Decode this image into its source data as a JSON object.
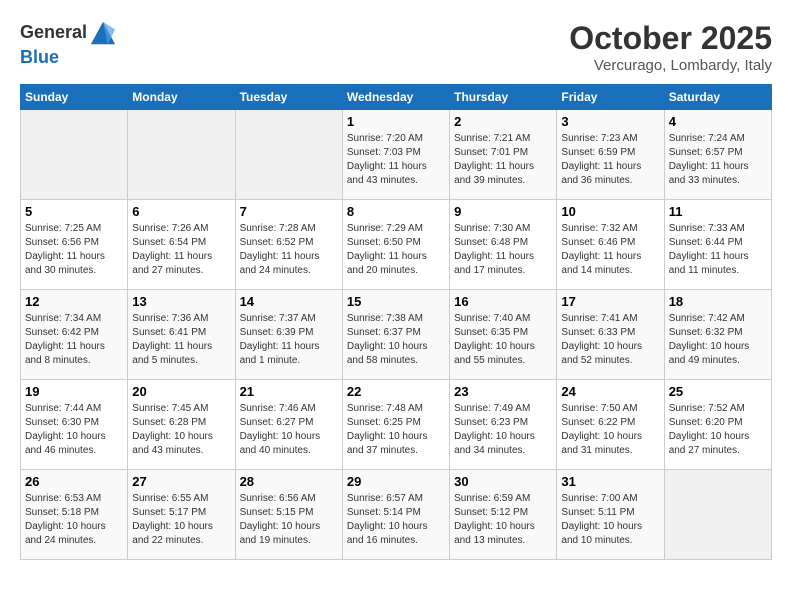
{
  "logo": {
    "general": "General",
    "blue": "Blue"
  },
  "title": "October 2025",
  "location": "Vercurago, Lombardy, Italy",
  "days_of_week": [
    "Sunday",
    "Monday",
    "Tuesday",
    "Wednesday",
    "Thursday",
    "Friday",
    "Saturday"
  ],
  "weeks": [
    [
      {
        "day": "",
        "info": ""
      },
      {
        "day": "",
        "info": ""
      },
      {
        "day": "",
        "info": ""
      },
      {
        "day": "1",
        "info": "Sunrise: 7:20 AM\nSunset: 7:03 PM\nDaylight: 11 hours and 43 minutes."
      },
      {
        "day": "2",
        "info": "Sunrise: 7:21 AM\nSunset: 7:01 PM\nDaylight: 11 hours and 39 minutes."
      },
      {
        "day": "3",
        "info": "Sunrise: 7:23 AM\nSunset: 6:59 PM\nDaylight: 11 hours and 36 minutes."
      },
      {
        "day": "4",
        "info": "Sunrise: 7:24 AM\nSunset: 6:57 PM\nDaylight: 11 hours and 33 minutes."
      }
    ],
    [
      {
        "day": "5",
        "info": "Sunrise: 7:25 AM\nSunset: 6:56 PM\nDaylight: 11 hours and 30 minutes."
      },
      {
        "day": "6",
        "info": "Sunrise: 7:26 AM\nSunset: 6:54 PM\nDaylight: 11 hours and 27 minutes."
      },
      {
        "day": "7",
        "info": "Sunrise: 7:28 AM\nSunset: 6:52 PM\nDaylight: 11 hours and 24 minutes."
      },
      {
        "day": "8",
        "info": "Sunrise: 7:29 AM\nSunset: 6:50 PM\nDaylight: 11 hours and 20 minutes."
      },
      {
        "day": "9",
        "info": "Sunrise: 7:30 AM\nSunset: 6:48 PM\nDaylight: 11 hours and 17 minutes."
      },
      {
        "day": "10",
        "info": "Sunrise: 7:32 AM\nSunset: 6:46 PM\nDaylight: 11 hours and 14 minutes."
      },
      {
        "day": "11",
        "info": "Sunrise: 7:33 AM\nSunset: 6:44 PM\nDaylight: 11 hours and 11 minutes."
      }
    ],
    [
      {
        "day": "12",
        "info": "Sunrise: 7:34 AM\nSunset: 6:42 PM\nDaylight: 11 hours and 8 minutes."
      },
      {
        "day": "13",
        "info": "Sunrise: 7:36 AM\nSunset: 6:41 PM\nDaylight: 11 hours and 5 minutes."
      },
      {
        "day": "14",
        "info": "Sunrise: 7:37 AM\nSunset: 6:39 PM\nDaylight: 11 hours and 1 minute."
      },
      {
        "day": "15",
        "info": "Sunrise: 7:38 AM\nSunset: 6:37 PM\nDaylight: 10 hours and 58 minutes."
      },
      {
        "day": "16",
        "info": "Sunrise: 7:40 AM\nSunset: 6:35 PM\nDaylight: 10 hours and 55 minutes."
      },
      {
        "day": "17",
        "info": "Sunrise: 7:41 AM\nSunset: 6:33 PM\nDaylight: 10 hours and 52 minutes."
      },
      {
        "day": "18",
        "info": "Sunrise: 7:42 AM\nSunset: 6:32 PM\nDaylight: 10 hours and 49 minutes."
      }
    ],
    [
      {
        "day": "19",
        "info": "Sunrise: 7:44 AM\nSunset: 6:30 PM\nDaylight: 10 hours and 46 minutes."
      },
      {
        "day": "20",
        "info": "Sunrise: 7:45 AM\nSunset: 6:28 PM\nDaylight: 10 hours and 43 minutes."
      },
      {
        "day": "21",
        "info": "Sunrise: 7:46 AM\nSunset: 6:27 PM\nDaylight: 10 hours and 40 minutes."
      },
      {
        "day": "22",
        "info": "Sunrise: 7:48 AM\nSunset: 6:25 PM\nDaylight: 10 hours and 37 minutes."
      },
      {
        "day": "23",
        "info": "Sunrise: 7:49 AM\nSunset: 6:23 PM\nDaylight: 10 hours and 34 minutes."
      },
      {
        "day": "24",
        "info": "Sunrise: 7:50 AM\nSunset: 6:22 PM\nDaylight: 10 hours and 31 minutes."
      },
      {
        "day": "25",
        "info": "Sunrise: 7:52 AM\nSunset: 6:20 PM\nDaylight: 10 hours and 27 minutes."
      }
    ],
    [
      {
        "day": "26",
        "info": "Sunrise: 6:53 AM\nSunset: 5:18 PM\nDaylight: 10 hours and 24 minutes."
      },
      {
        "day": "27",
        "info": "Sunrise: 6:55 AM\nSunset: 5:17 PM\nDaylight: 10 hours and 22 minutes."
      },
      {
        "day": "28",
        "info": "Sunrise: 6:56 AM\nSunset: 5:15 PM\nDaylight: 10 hours and 19 minutes."
      },
      {
        "day": "29",
        "info": "Sunrise: 6:57 AM\nSunset: 5:14 PM\nDaylight: 10 hours and 16 minutes."
      },
      {
        "day": "30",
        "info": "Sunrise: 6:59 AM\nSunset: 5:12 PM\nDaylight: 10 hours and 13 minutes."
      },
      {
        "day": "31",
        "info": "Sunrise: 7:00 AM\nSunset: 5:11 PM\nDaylight: 10 hours and 10 minutes."
      },
      {
        "day": "",
        "info": ""
      }
    ]
  ]
}
